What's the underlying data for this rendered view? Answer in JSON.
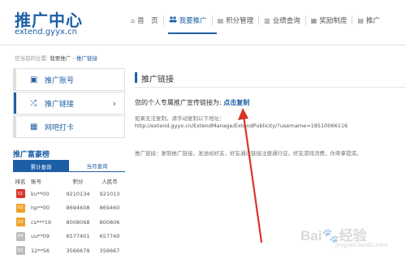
{
  "logo": {
    "title": "推广中心",
    "url": "extend.gyyx.cn"
  },
  "nav": [
    {
      "icon": "home-icon",
      "glyph": "⌂",
      "label": "首　页",
      "active": false
    },
    {
      "icon": "users-icon",
      "glyph": "👥",
      "label": "我要推广",
      "active": true
    },
    {
      "icon": "book-icon",
      "glyph": "▤",
      "label": "积分管理",
      "active": false
    },
    {
      "icon": "chart-icon",
      "glyph": "▥",
      "label": "业绩查询",
      "active": false
    },
    {
      "icon": "document-icon",
      "glyph": "▦",
      "label": "奖励制度",
      "active": false
    },
    {
      "icon": "book-icon",
      "glyph": "▤",
      "label": "推广",
      "active": false
    }
  ],
  "breadcrumb": {
    "prefix": "您当前的位置:",
    "parent": "我要推广",
    "sep": "›",
    "current": "推广链接"
  },
  "sidebar": [
    {
      "icon": "id-card-icon",
      "glyph": "▣",
      "label": "推广账号",
      "active": false
    },
    {
      "icon": "shuffle-icon",
      "glyph": "⤮",
      "label": "推广链接",
      "active": true,
      "chevron": "›"
    },
    {
      "icon": "calendar-icon",
      "glyph": "▦",
      "label": "网吧打卡",
      "active": false
    }
  ],
  "leaderboard": {
    "title": "推广富豪榜",
    "tabs": [
      "累计查询",
      "当月查询"
    ],
    "columns": [
      "排名",
      "账号",
      "积分",
      "人民币"
    ],
    "rows": [
      {
        "rank": "01",
        "color": "#d9342b",
        "account": "ku**00",
        "points": "9210134",
        "rmb": "921013"
      },
      {
        "rank": "02",
        "color": "#f0a12a",
        "account": "hp**00",
        "points": "8694608",
        "rmb": "869460"
      },
      {
        "rank": "03",
        "color": "#f0a12a",
        "account": "cs***19",
        "points": "8008068",
        "rmb": "800806"
      },
      {
        "rank": "04",
        "color": "#bcbcbc",
        "account": "uu**09",
        "points": "6577401",
        "rmb": "657740"
      },
      {
        "rank": "05",
        "color": "#bcbcbc",
        "account": "12**56",
        "points": "3566679",
        "rmb": "356667"
      }
    ]
  },
  "main": {
    "title": "推广链接",
    "promo_prefix": "您的个人专属推广宣传链接为:",
    "copy_label": "点击复制",
    "hint": "如果无法复制，请手动复制以下地址：",
    "url": "http://extend.gyyx.cn/ExtendManage/ExtendPublicity/?username=18510066116",
    "rule": "推广链接：复制推广链接，发送给好友，好友通过链接注册通行证，好友游戏消费，你来拿提成。"
  },
  "colors": {
    "accent": "#1d5fa6",
    "arrow": "#d9342b"
  },
  "watermark": {
    "brand": "Bai🐾经验",
    "url": "jingyan.baidu.com"
  }
}
